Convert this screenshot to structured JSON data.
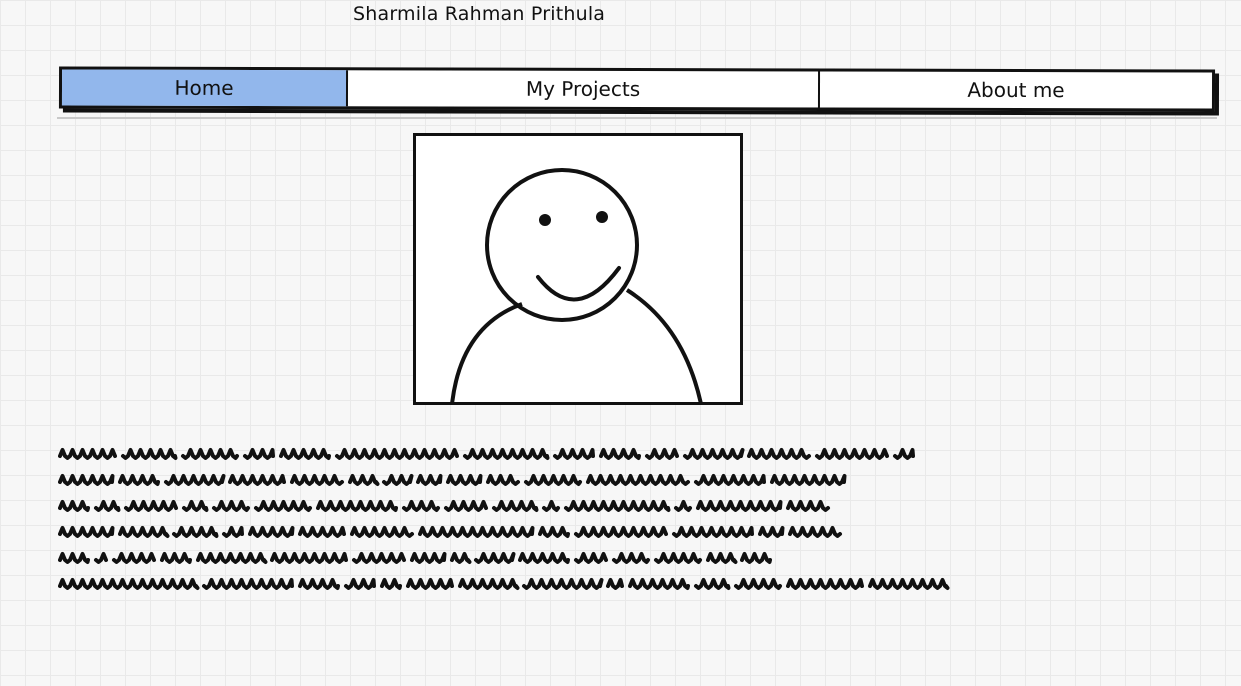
{
  "site": {
    "title": "Sharmila Rahman Prithula"
  },
  "nav": {
    "tabs": [
      {
        "label": "Home",
        "active": true
      },
      {
        "label": "My Projects",
        "active": false
      },
      {
        "label": "About me",
        "active": false
      }
    ],
    "active_color": "#92b7ec"
  },
  "profile_image": {
    "icon": "person-placeholder-icon"
  },
  "body_text": {
    "style": "scribble-placeholder",
    "line_count": 6
  }
}
